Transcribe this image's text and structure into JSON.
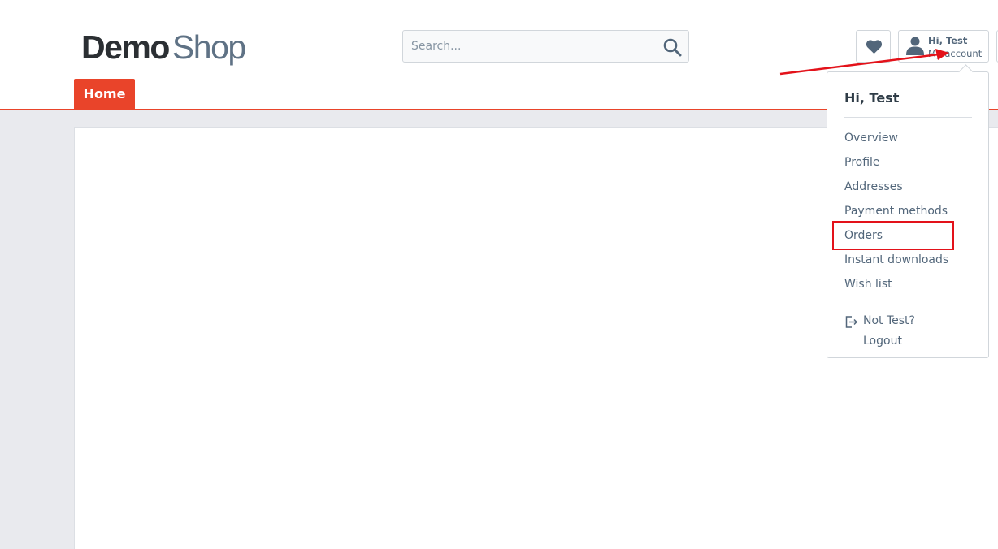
{
  "logo": {
    "part1": "Demo",
    "part2": "Shop"
  },
  "search": {
    "placeholder": "Search...",
    "icon": "search-icon"
  },
  "header": {
    "wishlist_icon": "heart-icon",
    "account": {
      "greeting": "Hi, Test",
      "label": "My account",
      "icon": "user-icon"
    }
  },
  "nav": {
    "home": "Home"
  },
  "account_menu": {
    "title": "Hi, Test",
    "items": [
      "Overview",
      "Profile",
      "Addresses",
      "Payment methods",
      "Orders",
      "Instant downloads",
      "Wish list"
    ],
    "not_user": "Not Test?",
    "logout": "Logout",
    "logout_icon": "logout-icon"
  },
  "colors": {
    "accent": "#e9442a",
    "text": "#52667a",
    "annotation": "#e3121a",
    "background": "#e9eaee"
  }
}
